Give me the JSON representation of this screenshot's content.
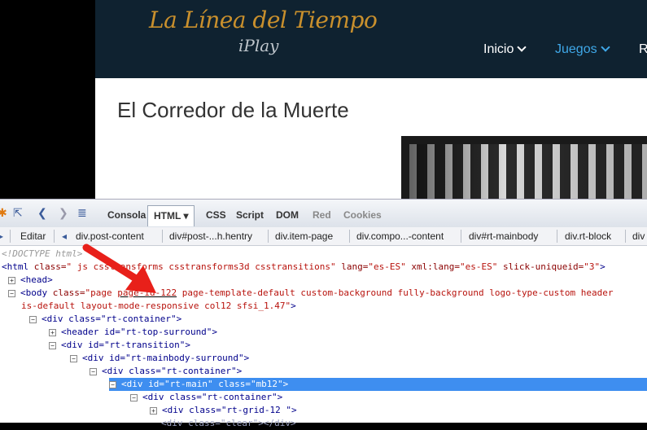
{
  "site": {
    "logo_title": "La Línea del Tiempo",
    "logo_sub": "iPlay",
    "nav": [
      {
        "label": "Inicio"
      },
      {
        "label": "Juegos"
      },
      {
        "label": "R"
      }
    ],
    "page_heading": "El Corredor de la Muerte",
    "colors": {
      "header": "#0f2230",
      "logo": "#c9902d",
      "nav_active": "#3fa8e8"
    }
  },
  "firebug": {
    "toolbar": {
      "icons": [
        "bug-icon",
        "inspect-icon",
        "back-icon",
        "forward-icon",
        "console-toggle-icon"
      ],
      "tabs": [
        {
          "label": "Consola"
        },
        {
          "label": "HTML ▾"
        },
        {
          "label": "CSS"
        },
        {
          "label": "Script"
        },
        {
          "label": "DOM"
        },
        {
          "label": "Red"
        },
        {
          "label": "Cookies"
        }
      ]
    },
    "breadcrumb": {
      "edit_label": "Editar",
      "items": [
        "div.post-content",
        "div#post-...h.hentry",
        "div.item-page",
        "div.compo...-content",
        "div#rt-mainbody",
        "div.rt-block",
        "div"
      ]
    },
    "tree": {
      "doctype": "<!DOCTYPE html>",
      "html_open": "<html",
      "html_class_attr": " class=",
      "html_class_val": "\" js csstransforms csstransforms3d csstransitions\"",
      "html_lang_attr": " lang=",
      "html_lang_val": "\"es-ES\"",
      "html_xmllang_attr": " xml:lang=",
      "html_xmllang_val": "\"es-ES\"",
      "html_slick_attr": " slick-uniqueid=",
      "html_slick_val": "\"3\"",
      "html_close": ">",
      "head": "<head>",
      "body_open": "<body",
      "body_class_attr": " class=",
      "body_class_q": "\"page ",
      "body_class_hl": "page-id-122",
      "body_class_rest": " page-template-default custom-background fully-background logo-type-custom header",
      "body_class_line2": "is-default layout-mode-responsive col12 sfsi_1.47\"",
      "body_close": ">",
      "rt_container": "<div class=\"rt-container\">",
      "header_rt_top": "<header id=\"rt-top-surround\">",
      "rt_transition": "<div id=\"rt-transition\">",
      "rt_mainbody_surround": "<div id=\"rt-mainbody-surround\">",
      "rt_container_2": "<div class=\"rt-container\">",
      "rt_main": "<div id=\"rt-main\" class=\"mb12\">",
      "rt_container_3": "<div class=\"rt-container\">",
      "rt_grid": "<div class=\"rt-grid-12 \">",
      "clear": "<div class=\"clear\"></div>"
    }
  }
}
